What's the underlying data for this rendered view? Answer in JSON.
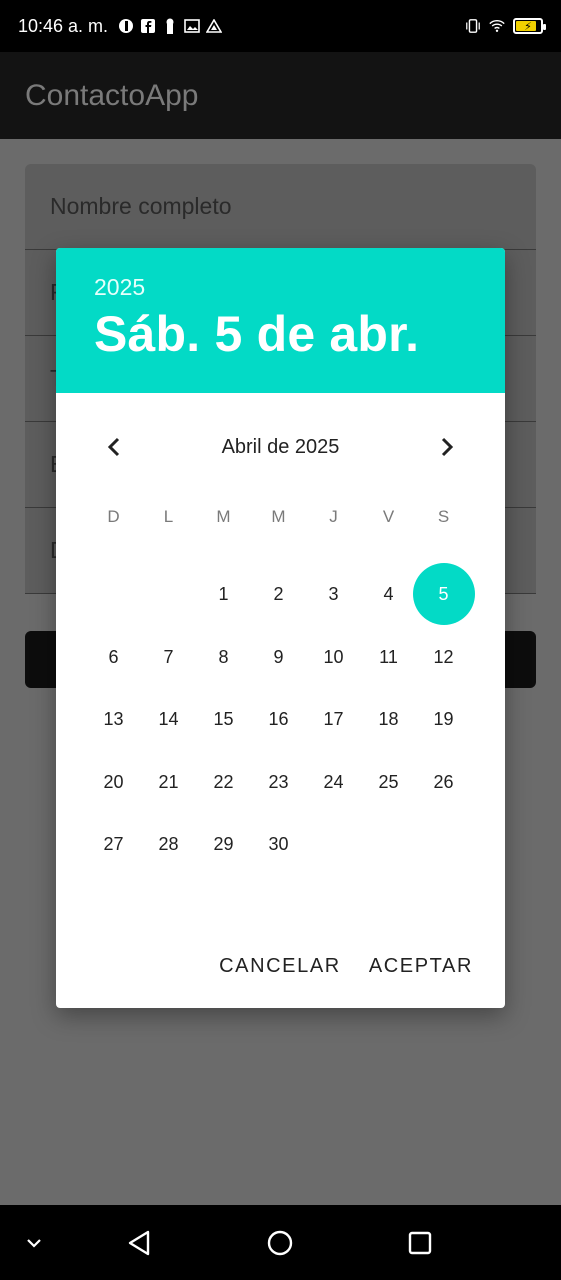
{
  "status_bar": {
    "time": "10:46 a. m."
  },
  "app": {
    "title": "ContactoApp"
  },
  "form": {
    "fields": [
      {
        "placeholder": "Nombre completo"
      },
      {
        "placeholder": "F"
      },
      {
        "placeholder": "T"
      },
      {
        "placeholder": "E"
      },
      {
        "placeholder": "D"
      }
    ]
  },
  "date_picker": {
    "header_year": "2025",
    "header_date": "Sáb. 5 de abr.",
    "month_label": "Abril de 2025",
    "weekdays": [
      "D",
      "L",
      "M",
      "M",
      "J",
      "V",
      "S"
    ],
    "weeks": [
      [
        "",
        "",
        "1",
        "2",
        "3",
        "4",
        "5"
      ],
      [
        "6",
        "7",
        "8",
        "9",
        "10",
        "11",
        "12"
      ],
      [
        "13",
        "14",
        "15",
        "16",
        "17",
        "18",
        "19"
      ],
      [
        "20",
        "21",
        "22",
        "23",
        "24",
        "25",
        "26"
      ],
      [
        "27",
        "28",
        "29",
        "30",
        "",
        "",
        ""
      ]
    ],
    "selected_day": "5",
    "cancel_label": "CANCELAR",
    "accept_label": "ACEPTAR",
    "accent_color": "#03dac6"
  }
}
